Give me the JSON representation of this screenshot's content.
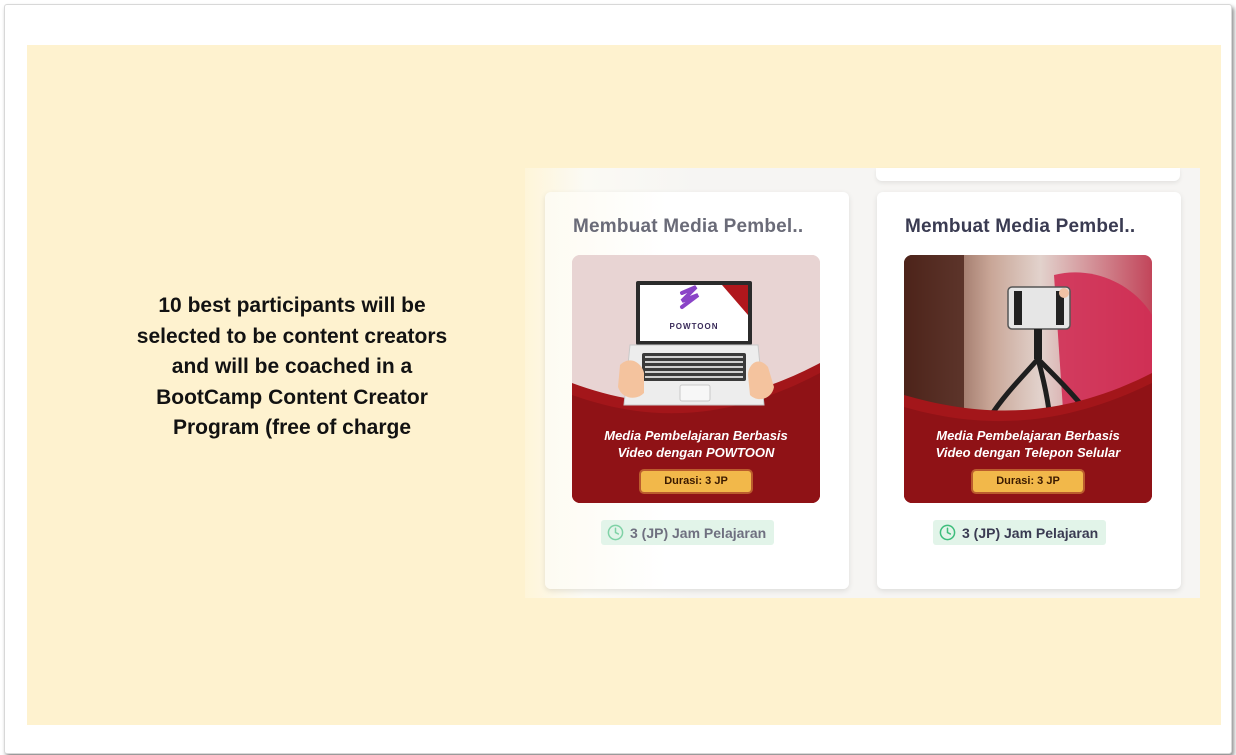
{
  "caption": {
    "line1": "10 best participants  will be",
    "line2": "selected to be content creators",
    "line3": "and will be coached in a",
    "line4": "BootCamp Content Creator",
    "line5": "Program (free of charge"
  },
  "courses": [
    {
      "title": "Membuat Media Pembel..",
      "thumb_logo": "POWTOON",
      "thumb_line1": "Media Pembelajaran Berbasis",
      "thumb_line2": "Video dengan POWTOON",
      "thumb_badge": "Durasi: 3 JP",
      "duration": "3 (JP) Jam Pelajaran",
      "icon": "clock-icon"
    },
    {
      "title": "Membuat Media Pembel..",
      "thumb_line1": "Media Pembelajaran Berbasis",
      "thumb_line2": "Video dengan Telepon Selular",
      "thumb_badge": "Durasi: 3 JP",
      "duration": "3 (JP) Jam Pelajaran",
      "icon": "clock-icon"
    }
  ],
  "colors": {
    "slide_background": "#fef2cf",
    "thumb_red": "#a3161a",
    "badge_gold": "#f2b84a",
    "duration_badge": "#e2f4e9",
    "clock_green": "#3dbd7b"
  }
}
